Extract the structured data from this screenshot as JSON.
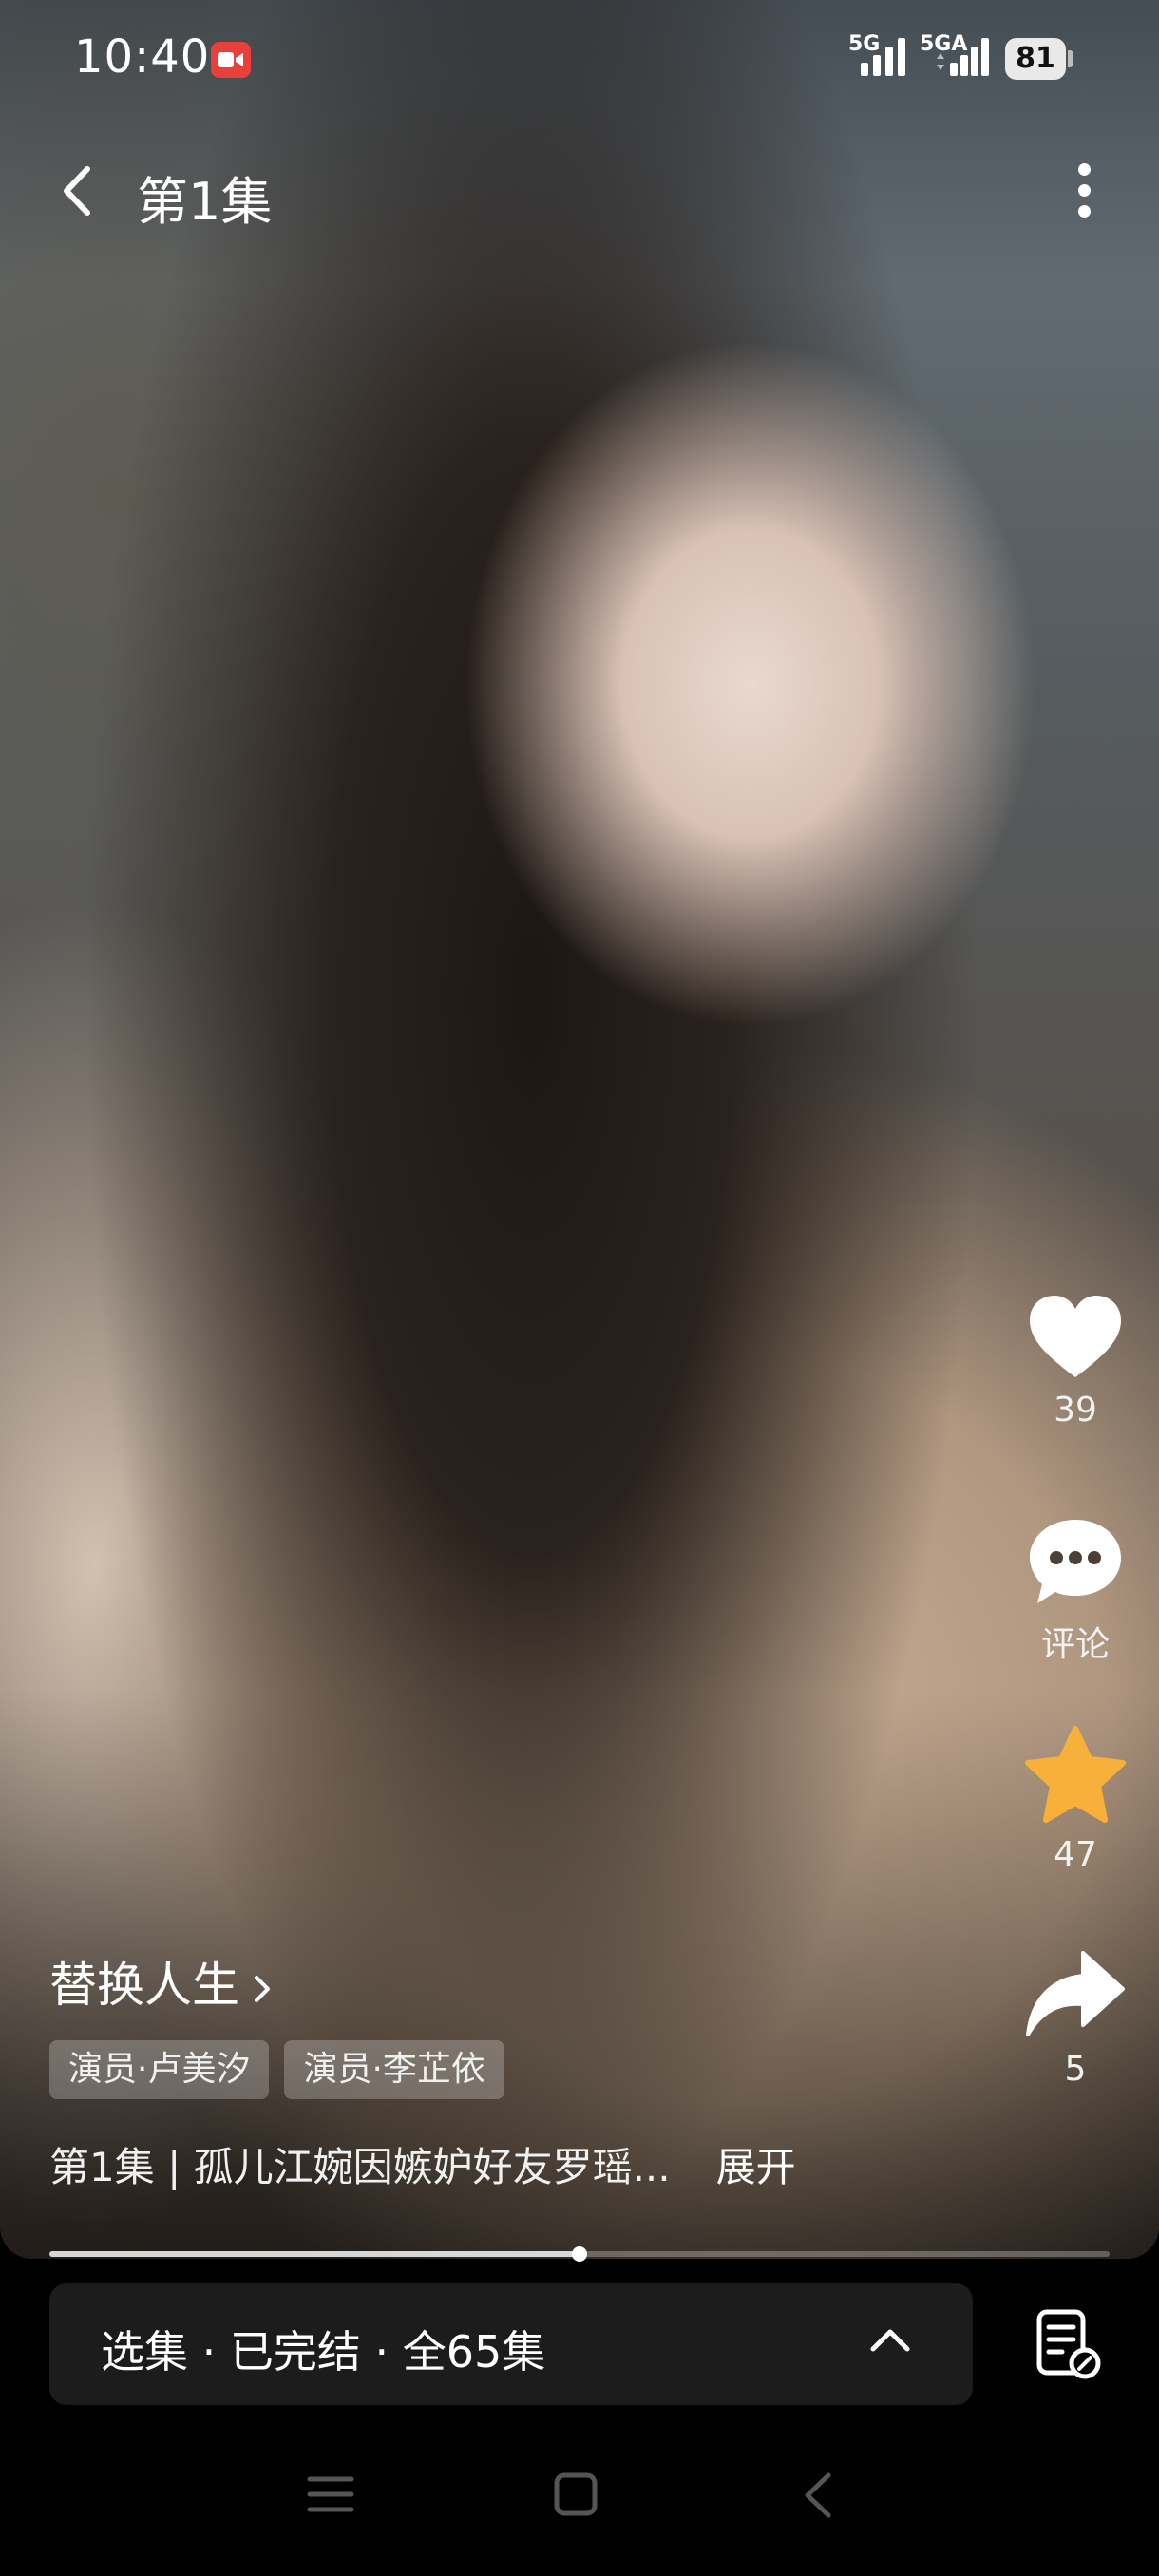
{
  "status_bar": {
    "time": "10:40",
    "network_1": "5G",
    "network_2": "5GA",
    "battery": "81",
    "icons": [
      "screen-record-icon",
      "signal-icon",
      "signal-icon",
      "battery-icon"
    ]
  },
  "header": {
    "title": "第1集",
    "back_icon": "chevron-left-icon",
    "more_icon": "more-vertical-icon"
  },
  "actions": {
    "like": {
      "icon": "heart-icon",
      "count": "39"
    },
    "comment": {
      "icon": "comment-icon",
      "label": "评论"
    },
    "favorite": {
      "icon": "star-icon",
      "count": "47",
      "color": "#f7b13a"
    },
    "share": {
      "icon": "share-icon",
      "count": "5"
    }
  },
  "drama": {
    "title": "替换人生",
    "tags": [
      "演员·卢美汐",
      "演员·李芷依"
    ],
    "synopsis": "第1集 | 孤儿江婉因嫉妒好友罗瑶...",
    "expand_label": "展开"
  },
  "progress": {
    "played_fraction": 0.5
  },
  "episode_bar": {
    "label": "选集 · 已完结 · 全65集",
    "chevron_icon": "chevron-up-icon",
    "list_icon": "episode-list-icon"
  },
  "system_nav": {
    "icons": [
      "menu-icon",
      "home-icon",
      "back-icon"
    ]
  }
}
